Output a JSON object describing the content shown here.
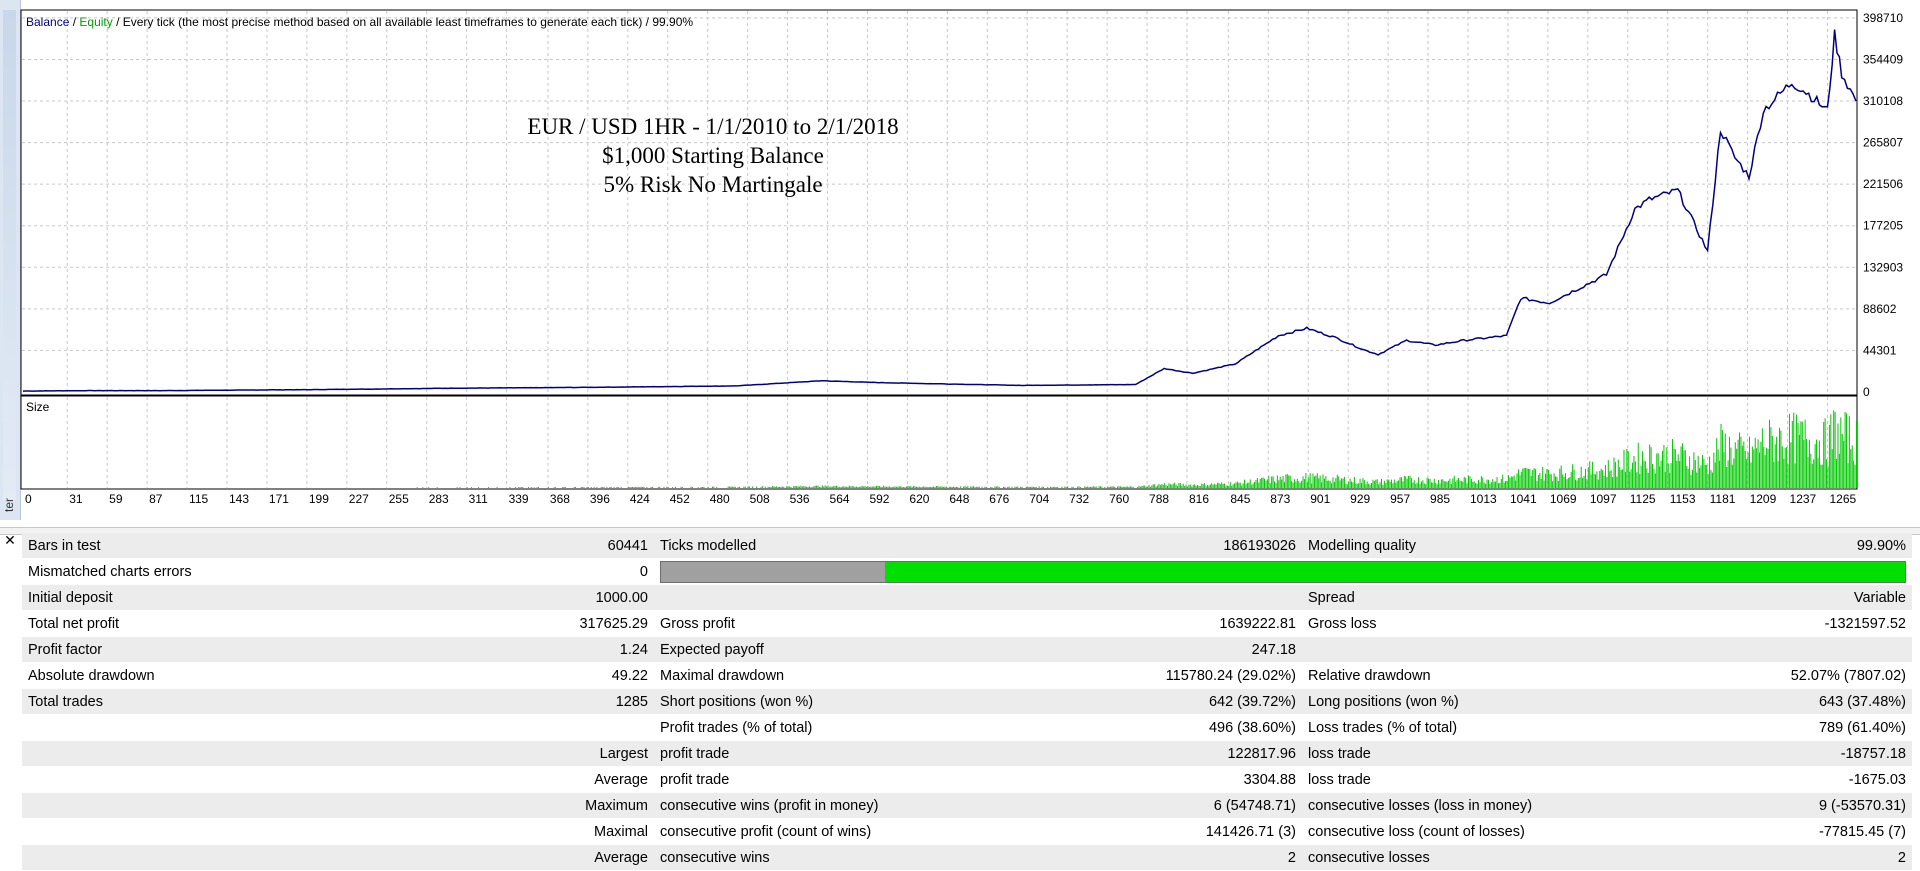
{
  "chart": {
    "legend": {
      "balance": "Balance",
      "sep1": " / ",
      "equity": "Equity",
      "rest": " / Every tick (the most precise method based on all available least timeframes to generate each tick) / 99.90%"
    },
    "overlay_lines": [
      "EUR / USD 1HR - 1/1/2010 to 2/1/2018",
      "$1,000 Starting Balance",
      "5% Risk No Martingale"
    ],
    "size_label": "Size",
    "colors": {
      "balance": "#000080",
      "equity": "#00a000",
      "size_bars": "#00c800",
      "grid": "#c8c8c8"
    }
  },
  "chart_data": {
    "type": "line",
    "x_ticks": [
      0,
      31,
      59,
      87,
      115,
      143,
      171,
      199,
      227,
      255,
      283,
      311,
      339,
      368,
      396,
      424,
      452,
      480,
      508,
      536,
      564,
      592,
      620,
      648,
      676,
      704,
      732,
      760,
      788,
      816,
      845,
      873,
      901,
      929,
      957,
      985,
      1013,
      1041,
      1069,
      1097,
      1125,
      1153,
      1181,
      1209,
      1237,
      1265
    ],
    "y_ticks": [
      398710,
      354409,
      310108,
      265807,
      221506,
      177205,
      132903,
      88602,
      44301,
      0
    ],
    "xlim": [
      0,
      1285
    ],
    "ylim": [
      0,
      405000
    ],
    "series": [
      {
        "name": "Balance",
        "x": [
          0,
          50,
          100,
          200,
          300,
          400,
          500,
          560,
          600,
          700,
          780,
          800,
          820,
          850,
          880,
          900,
          920,
          940,
          950,
          970,
          990,
          1010,
          1040,
          1050,
          1070,
          1090,
          1110,
          1130,
          1140,
          1160,
          1181,
          1190,
          1200,
          1210,
          1220,
          1240,
          1250,
          1265,
          1270,
          1275,
          1285
        ],
        "y": [
          1000,
          1500,
          1500,
          2500,
          4000,
          5000,
          6500,
          12000,
          10000,
          7000,
          8000,
          25000,
          20000,
          30000,
          60000,
          68000,
          58000,
          45000,
          40000,
          55000,
          50000,
          55000,
          60000,
          100000,
          95000,
          110000,
          125000,
          195000,
          205000,
          215000,
          150000,
          280000,
          250000,
          230000,
          300000,
          330000,
          320000,
          300000,
          380000,
          340000,
          310000
        ]
      }
    ],
    "size_bars_note": ""
  },
  "report": {
    "rows": [
      [
        "Bars in test",
        "60441",
        "Ticks modelled",
        "186193026",
        "Modelling quality",
        "99.90%"
      ],
      [
        "Mismatched charts errors",
        "0",
        "",
        "",
        "",
        ""
      ],
      [
        "Initial deposit",
        "1000.00",
        "",
        "",
        "Spread",
        "Variable"
      ],
      [
        "Total net profit",
        "317625.29",
        "Gross profit",
        "1639222.81",
        "Gross loss",
        "-1321597.52"
      ],
      [
        "Profit factor",
        "1.24",
        "Expected payoff",
        "247.18",
        "",
        ""
      ],
      [
        "Absolute drawdown",
        "49.22",
        "Maximal drawdown",
        "115780.24 (29.02%)",
        "Relative drawdown",
        "52.07% (7807.02)"
      ],
      [
        "Total trades",
        "1285",
        "Short positions (won %)",
        "642 (39.72%)",
        "Long positions (won %)",
        "643 (37.48%)"
      ],
      [
        "",
        "",
        "Profit trades (% of total)",
        "496 (38.60%)",
        "Loss trades (% of total)",
        "789 (61.40%)"
      ],
      [
        "",
        "Largest",
        "profit trade",
        "122817.96",
        "loss trade",
        "-18757.18"
      ],
      [
        "",
        "Average",
        "profit trade",
        "3304.88",
        "loss trade",
        "-1675.03"
      ],
      [
        "",
        "Maximum",
        "consecutive wins (profit in money)",
        "6 (54748.71)",
        "consecutive losses (loss in money)",
        "9 (-53570.31)"
      ],
      [
        "",
        "Maximal",
        "consecutive profit (count of wins)",
        "141426.71 (3)",
        "consecutive loss (count of losses)",
        "-77815.45 (7)"
      ],
      [
        "",
        "Average",
        "consecutive wins",
        "2",
        "consecutive losses",
        "2"
      ]
    ],
    "modelling_quality_fraction": 0.18,
    "rail_label": "ter"
  }
}
